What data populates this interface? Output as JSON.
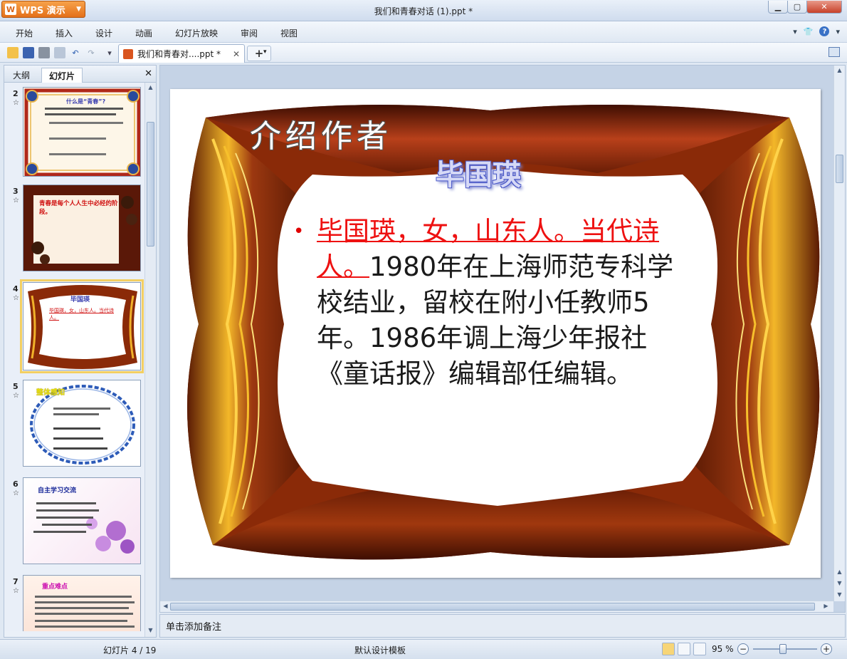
{
  "app": {
    "name": "WPS 演示",
    "window_title": "我们和青春对话 (1).ppt *"
  },
  "menu": [
    "开始",
    "插入",
    "设计",
    "动画",
    "幻灯片放映",
    "审阅",
    "视图"
  ],
  "toolbar": {
    "doc_tab": "我们和青春对....ppt *",
    "new_tab": "+"
  },
  "left_pane": {
    "tabs": [
      "大纲",
      "幻灯片"
    ],
    "thumbnails": [
      {
        "num": "2",
        "title": "什么是“青春”?"
      },
      {
        "num": "3",
        "text": "青春是每个人人生中必经的阶段。"
      },
      {
        "num": "4",
        "title": "毕国瑛",
        "text": "毕国瑛，女，山东人。当代诗人。",
        "selected": true
      },
      {
        "num": "5",
        "title": "整体感知"
      },
      {
        "num": "6",
        "title": "自主学习交流"
      },
      {
        "num": "7",
        "title": "重点难点"
      }
    ]
  },
  "slide": {
    "heading": "介绍作者",
    "name": "毕国瑛",
    "body_red": "毕国瑛，女，山东人。当代诗人。",
    "body_rest": "1980年在上海师范专科学校结业，留校在附小任教师5年。1986年调上海少年报社《童话报》编辑部任编辑。"
  },
  "notes_placeholder": "单击添加备注",
  "status": {
    "slide_counter": "幻灯片 4 / 19",
    "template": "默认设计模板",
    "zoom": "95 %"
  },
  "colors": {
    "accent_orange": "#e4701a",
    "frame_dark": "#8a2a08",
    "frame_gold": "#f0b22a",
    "body_red": "#ee1111"
  }
}
